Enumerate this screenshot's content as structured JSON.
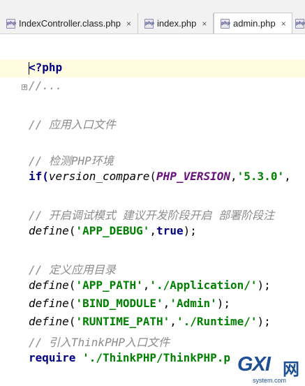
{
  "tabs": [
    {
      "label": "IndexController.class.php",
      "icon": "php-file-icon",
      "active": false
    },
    {
      "label": "index.php",
      "icon": "php-file-icon",
      "active": false
    },
    {
      "label": "admin.php",
      "icon": "php-file-icon",
      "active": true
    }
  ],
  "tab_close": "×",
  "php_icon_text": "php",
  "fold_marker": "+",
  "code": {
    "l1": "<?php",
    "l2": "//...",
    "l3": "// 应用入口文件",
    "l4": "// 检测PHP环境",
    "l5a": "if(",
    "l5b": "version_compare",
    "l5c": "(",
    "l5d": "PHP_VERSION",
    "l5e": ",",
    "l5f": "'5.3.0'",
    "l5g": ",",
    "l6": "// 开启调试模式 建议开发阶段开启 部署阶段注",
    "l7a": "define",
    "l7b": "(",
    "l7c": "'APP_DEBUG'",
    "l7d": ",",
    "l7e": "true",
    "l7f": ");",
    "l8": "// 定义应用目录",
    "l9a": "define",
    "l9b": "(",
    "l9c": "'APP_PATH'",
    "l9d": ",",
    "l9e": "'./Application/'",
    "l9f": ");",
    "l10a": "define",
    "l10b": "(",
    "l10c": "'BIND_MODULE'",
    "l10d": ",",
    "l10e": "'Admin'",
    "l10f": ");",
    "l11a": "define",
    "l11b": "(",
    "l11c": "'RUNTIME_PATH'",
    "l11d": ",",
    "l11e": "'./Runtime/'",
    "l11f": ");",
    "l12": "// 引入ThinkPHP入口文件",
    "l13a": "require",
    "l13b": " './ThinkPHP/ThinkPHP.p"
  },
  "watermark": {
    "brand": "GXI",
    "cn": "网",
    "domain": "system.com"
  },
  "colors": {
    "comment": "#8c8c8c",
    "keyword": "#000080",
    "string": "#008000",
    "constant": "#660e7a",
    "current_line": "#fffbe0"
  }
}
